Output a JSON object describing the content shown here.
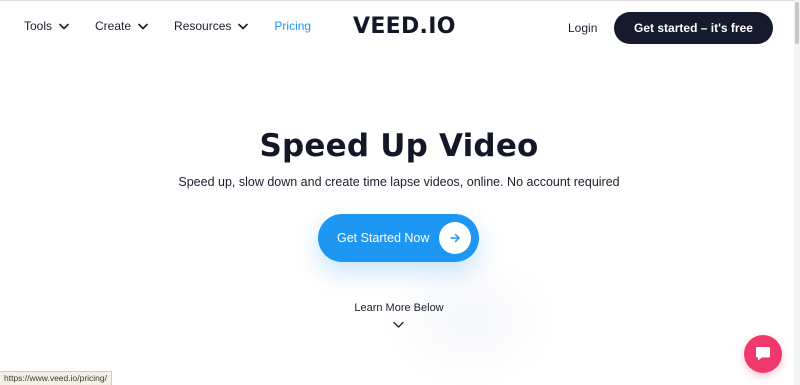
{
  "nav": {
    "items": [
      {
        "label": "Tools",
        "has_dropdown": true
      },
      {
        "label": "Create",
        "has_dropdown": true
      },
      {
        "label": "Resources",
        "has_dropdown": true
      },
      {
        "label": "Pricing",
        "has_dropdown": false,
        "active": true
      }
    ],
    "logo": "VEED.IO",
    "login_label": "Login",
    "cta_label": "Get started – it's free"
  },
  "hero": {
    "title": "Speed Up Video",
    "subtitle": "Speed up, slow down and create time lapse videos, online. No account required",
    "cta_label": "Get Started Now",
    "cta_icon": "arrow-right-icon",
    "learn_more": "Learn More Below"
  },
  "chat": {
    "icon": "chat-bubble-icon"
  },
  "status_bar": {
    "url": "https://www.veed.io/pricing/"
  },
  "colors": {
    "accent_blue": "#1e97f2",
    "dark_navy": "#151a2d",
    "chat_pink": "#f0386b"
  }
}
